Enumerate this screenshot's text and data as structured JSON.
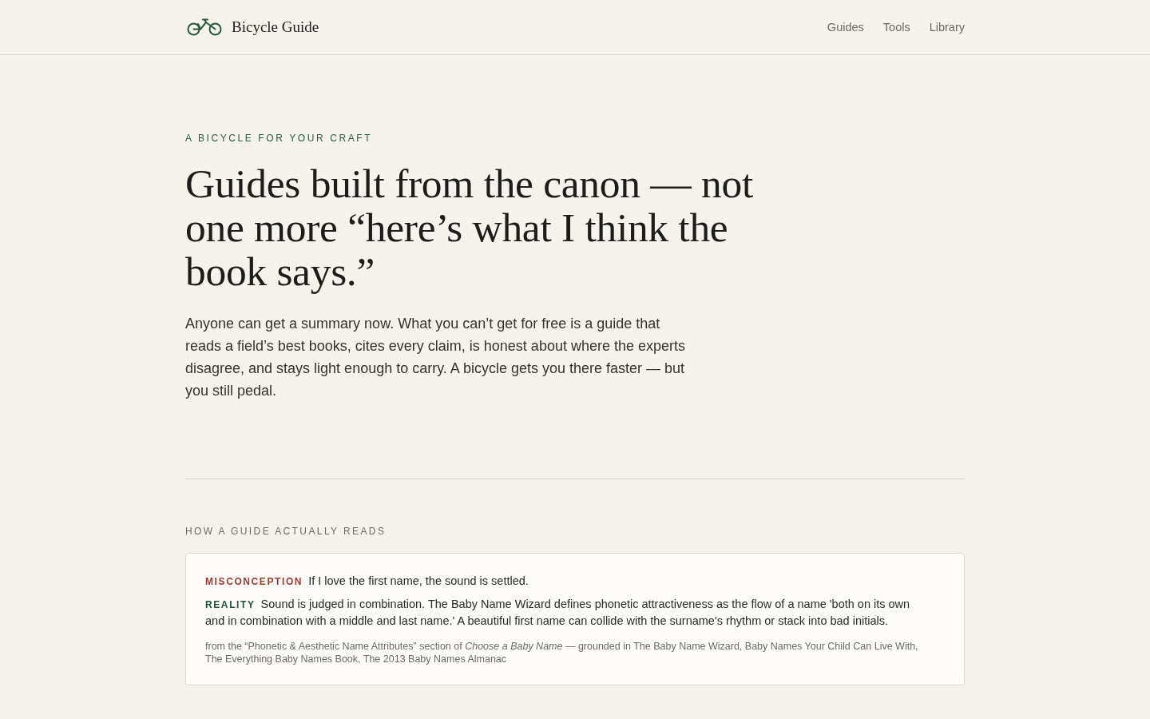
{
  "header": {
    "brand": "Bicycle Guide",
    "nav": [
      "Guides",
      "Tools",
      "Library"
    ]
  },
  "hero": {
    "eyebrow": "A BICYCLE FOR YOUR CRAFT",
    "headline": "Guides built from the canon — not one more “here’s what I think the book says.”",
    "lead": "Anyone can get a summary now. What you can’t get for free is a guide that reads a field’s best books, cites every claim, is honest about where the experts disagree, and stays light enough to carry. A bicycle gets you there faster — but you still pedal."
  },
  "section": {
    "label": "HOW A GUIDE ACTUALLY READS",
    "card": {
      "rows": [
        {
          "kind": "misconception",
          "label": "MISCONCEPTION",
          "text": "If I love the first name, the sound is settled."
        },
        {
          "kind": "reality",
          "label": "REALITY",
          "text": "Sound is judged in combination. The Baby Name Wizard defines phonetic attractiveness as the flow of a name 'both on its own and in combination with a middle and last name.' A beautiful first name can collide with the surname's rhythm or stack into bad initials."
        }
      ],
      "source": "from the “Phonetic & Aesthetic Name Attributes” section of *Choose a Baby Name* — grounded in The Baby Name Wizard, Baby Names Your Child Can Live With, The Everything Baby Names Book, The 2013 Baby Names Almanac"
    }
  }
}
